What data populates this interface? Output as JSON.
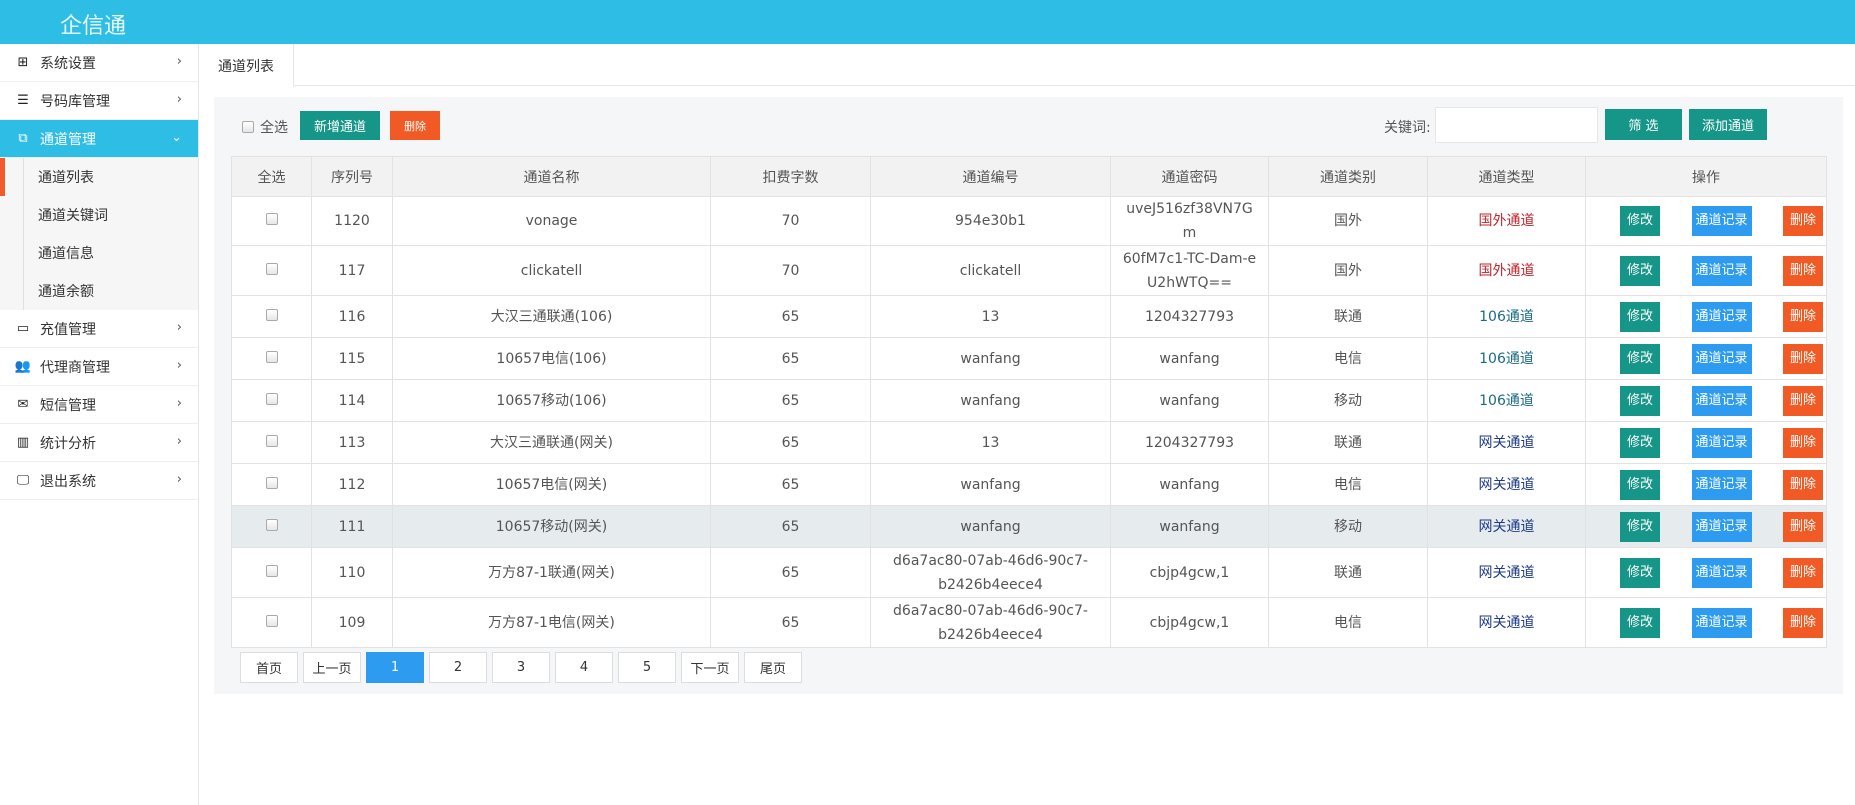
{
  "app": {
    "title": "企信通"
  },
  "sidebar": {
    "items": [
      {
        "label": "系统设置",
        "icon": "windows-icon"
      },
      {
        "label": "号码库管理",
        "icon": "server-icon"
      },
      {
        "label": "通道管理",
        "icon": "sitemap-icon"
      },
      {
        "label": "充值管理",
        "icon": "credit-card-icon"
      },
      {
        "label": "代理商管理",
        "icon": "users-icon"
      },
      {
        "label": "短信管理",
        "icon": "envelope-icon"
      },
      {
        "label": "统计分析",
        "icon": "bar-chart-icon"
      },
      {
        "label": "退出系统",
        "icon": "desktop-icon"
      }
    ],
    "sub_items": [
      "通道列表",
      "通道关键词",
      "通道信息",
      "通道余额"
    ]
  },
  "tabs": [
    {
      "label": "通道列表"
    }
  ],
  "toolbar": {
    "select_all": "全选",
    "new_label": "新增通道",
    "delete_label": "删除",
    "keyword_label": "关键词:",
    "keyword_value": "",
    "filter_label": "筛 选",
    "add_label": "添加通道"
  },
  "table": {
    "headers": [
      "全选",
      "序列号",
      "通道名称",
      "扣费字数",
      "通道编号",
      "通道密码",
      "通道类别",
      "通道类型",
      "操作"
    ],
    "actions": {
      "edit": "修改",
      "records": "通道记录",
      "delete": "删除"
    },
    "rows": [
      {
        "id": "1120",
        "name": "vonage",
        "chars": "70",
        "code": "954e30b1",
        "pwd": "uveJ516zf38VN7Gm",
        "cat": "国外",
        "type": "国外通道"
      },
      {
        "id": "117",
        "name": "clickatell",
        "chars": "70",
        "code": "clickatell",
        "pwd": "60fM7c1-TC-Dam-eU2hWTQ==",
        "cat": "国外",
        "type": "国外通道"
      },
      {
        "id": "116",
        "name": "大汉三通联通(106)",
        "chars": "65",
        "code": "13",
        "pwd": "1204327793",
        "cat": "联通",
        "type": "106通道"
      },
      {
        "id": "115",
        "name": "10657电信(106)",
        "chars": "65",
        "code": "wanfang",
        "pwd": "wanfang",
        "cat": "电信",
        "type": "106通道"
      },
      {
        "id": "114",
        "name": "10657移动(106)",
        "chars": "65",
        "code": "wanfang",
        "pwd": "wanfang",
        "cat": "移动",
        "type": "106通道"
      },
      {
        "id": "113",
        "name": "大汉三通联通(网关)",
        "chars": "65",
        "code": "13",
        "pwd": "1204327793",
        "cat": "联通",
        "type": "网关通道"
      },
      {
        "id": "112",
        "name": "10657电信(网关)",
        "chars": "65",
        "code": "wanfang",
        "pwd": "wanfang",
        "cat": "电信",
        "type": "网关通道"
      },
      {
        "id": "111",
        "name": "10657移动(网关)",
        "chars": "65",
        "code": "wanfang",
        "pwd": "wanfang",
        "cat": "移动",
        "type": "网关通道"
      },
      {
        "id": "110",
        "name": "万方87-1联通(网关)",
        "chars": "65",
        "code": "d6a7ac80-07ab-46d6-90c7-b2426b4eece4",
        "pwd": "cbjp4gcw,1",
        "cat": "联通",
        "type": "网关通道"
      },
      {
        "id": "109",
        "name": "万方87-1电信(网关)",
        "chars": "65",
        "code": "d6a7ac80-07ab-46d6-90c7-b2426b4eece4",
        "pwd": "cbjp4gcw,1",
        "cat": "电信",
        "type": "网关通道"
      }
    ]
  },
  "pagination": {
    "items": [
      "首页",
      "上一页",
      "1",
      "2",
      "3",
      "4",
      "5",
      "下一页",
      "尾页"
    ],
    "current": "1"
  },
  "colors": {
    "header": "#2ebde4",
    "teal": "#159688",
    "orange": "#f15a24",
    "blue": "#2d9bef"
  }
}
